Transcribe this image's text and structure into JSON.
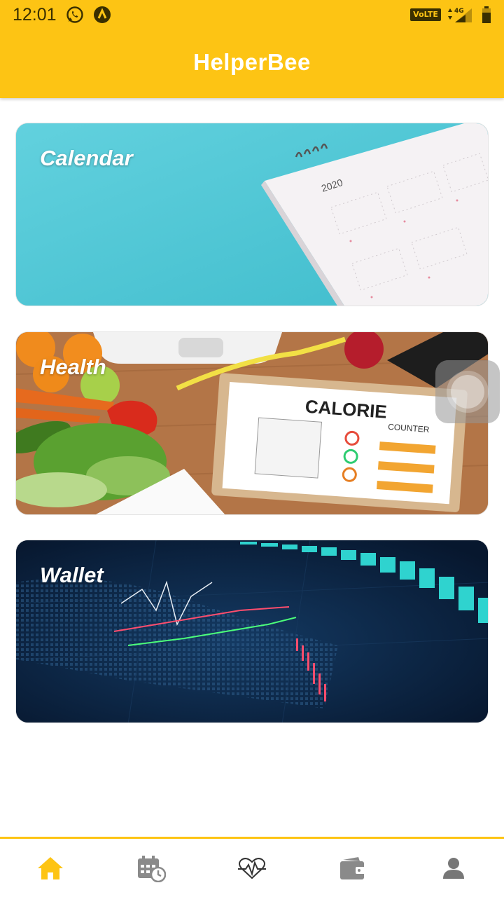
{
  "status_bar": {
    "time": "12:01",
    "network_label": "4G",
    "volte_label": "VoLTE",
    "icons": [
      "whatsapp-icon",
      "app-notification-icon",
      "signal-icon",
      "battery-icon"
    ]
  },
  "app_bar": {
    "title": "HelperBee",
    "background": "#FDC414"
  },
  "cards": [
    {
      "id": "calendar",
      "label": "Calendar",
      "image_text": "2020"
    },
    {
      "id": "health",
      "label": "Health",
      "image_text": "CALORIE",
      "image_subtext": "COUNTER"
    },
    {
      "id": "wallet",
      "label": "Wallet"
    }
  ],
  "bottom_nav": {
    "active_color": "#FDC414",
    "inactive_color": "#8a8a8a",
    "items": [
      {
        "icon": "home-icon",
        "active": true
      },
      {
        "icon": "calendar-clock-icon",
        "active": false
      },
      {
        "icon": "heartbeat-icon",
        "active": false
      },
      {
        "icon": "wallet-icon",
        "active": false
      },
      {
        "icon": "profile-icon",
        "active": false
      }
    ]
  }
}
